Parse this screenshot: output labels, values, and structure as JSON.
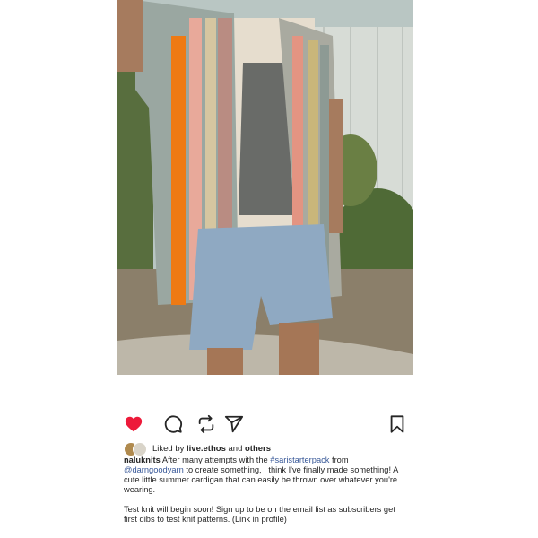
{
  "post": {
    "likes": {
      "prefix": "Liked by",
      "first_liker": "live.ethos",
      "connector": "and",
      "others": "others"
    },
    "caption": {
      "username": "naluknits",
      "t1": " After many attempts with the ",
      "hashtag": "#saristarterpack",
      "t2": " from ",
      "mention": "@darngoodyarn",
      "t3": " to create something, I think I've finally made something! A cute little summer cardigan that can easily be thrown over whatever you're wearing.",
      "paragraph2": "Test knit will begin soon! Sign up to be on the email list as subscribers get first dibs to test knit patterns. (Link in profile)"
    }
  },
  "icons": {
    "like": "heart-icon",
    "comment": "comment-icon",
    "share": "repost-icon",
    "send": "send-icon",
    "save": "bookmark-icon"
  },
  "colors": {
    "like_active": "#ed1a3a",
    "link": "#385898"
  }
}
